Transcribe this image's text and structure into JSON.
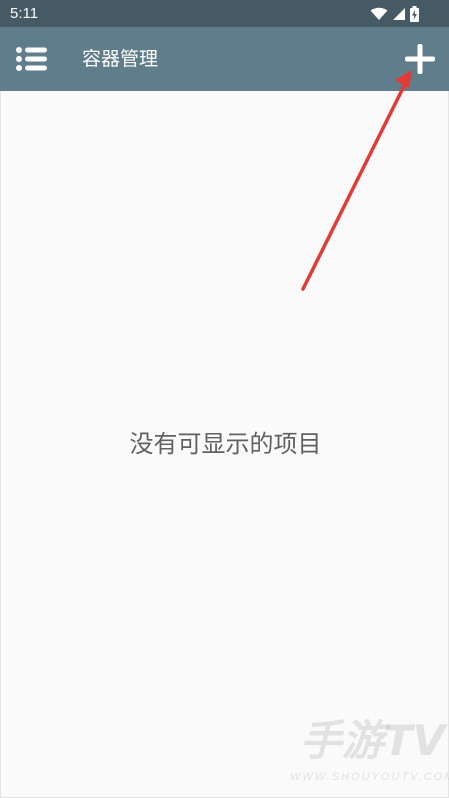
{
  "status_bar": {
    "time": "5:11",
    "icons": [
      "wifi-icon",
      "cellular-signal-icon",
      "battery-charging-icon"
    ]
  },
  "app_bar": {
    "title": "容器管理",
    "menu_icon": "menu-list-icon",
    "add_icon": "plus-icon"
  },
  "content": {
    "empty_message": "没有可显示的项目"
  },
  "watermark": {
    "main": "手游TV",
    "sub": "WWW.SHOUYOUTV.COM"
  },
  "colors": {
    "status_bar": "#455a64",
    "app_bar": "#607d8b",
    "background": "#fafafa",
    "empty_text": "#616161",
    "annotation_arrow": "#e53935"
  }
}
